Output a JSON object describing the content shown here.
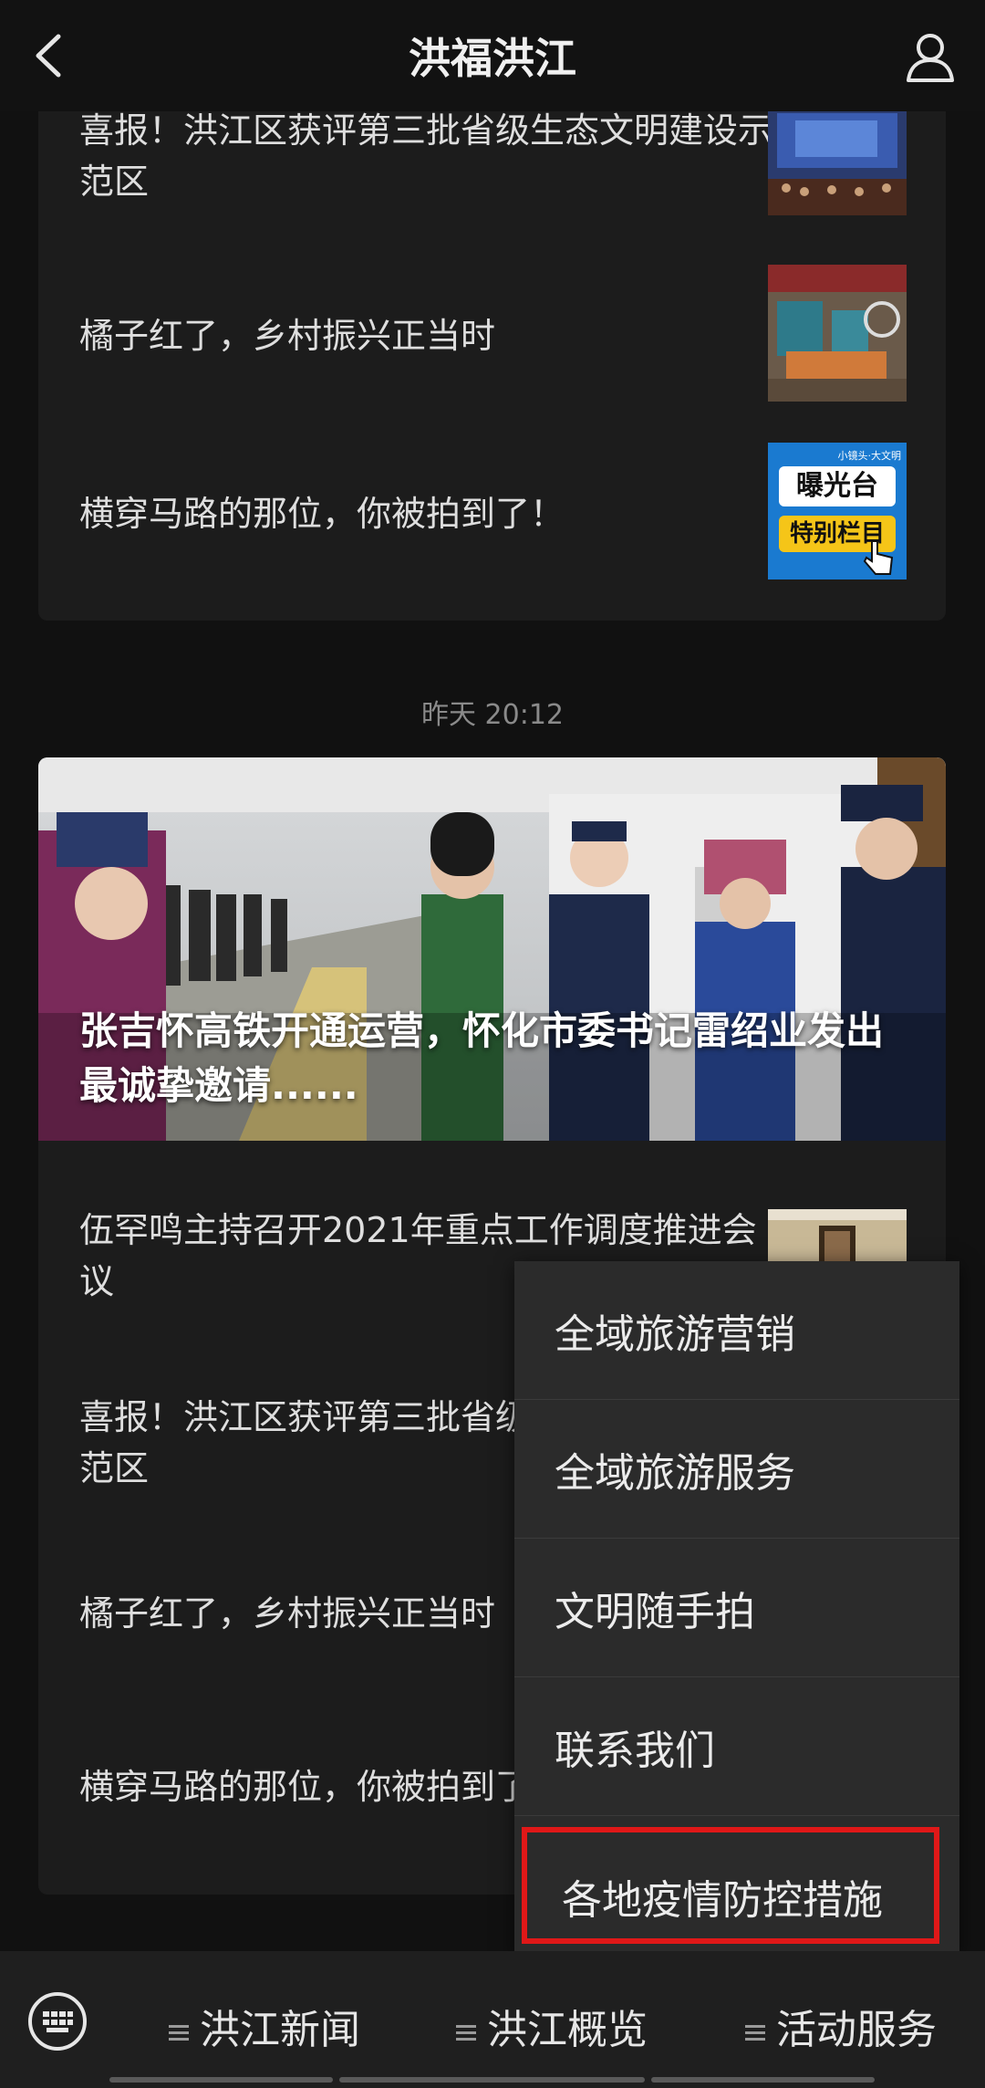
{
  "header": {
    "title": "洪福洪江"
  },
  "top_card": {
    "items": [
      {
        "text": "喜报！洪江区获评第三批省级生态文明建设示范区"
      },
      {
        "text": "橘子红了，乡村振兴正当时"
      },
      {
        "text": "横穿马路的那位，你被拍到了！"
      }
    ],
    "thumb3": {
      "line1": "小镜头·大文明",
      "line2": "曝光台",
      "line3": "特别栏目"
    }
  },
  "timestamp": "昨天 20:12",
  "main_card": {
    "hero_title": "张吉怀高铁开通运营，怀化市委书记雷绍业发出最诚挚邀请......",
    "items": [
      {
        "text": "伍罕鸣主持召开2021年重点工作调度推进会议"
      },
      {
        "text": "喜报！洪江区获评第三批省级生态文明建设示范区"
      },
      {
        "text": "橘子红了，乡村振兴正当时"
      },
      {
        "text": "横穿马路的那位，你被拍到了！"
      }
    ]
  },
  "popup_menu": {
    "items": [
      {
        "label": "全域旅游营销"
      },
      {
        "label": "全域旅游服务"
      },
      {
        "label": "文明随手拍"
      },
      {
        "label": "联系我们"
      },
      {
        "label": "各地疫情防控措施"
      }
    ],
    "highlight_color": "#e01818"
  },
  "bottom_bar": {
    "tabs": [
      {
        "label": "洪江新闻"
      },
      {
        "label": "洪江概览"
      },
      {
        "label": "活动服务"
      }
    ]
  }
}
